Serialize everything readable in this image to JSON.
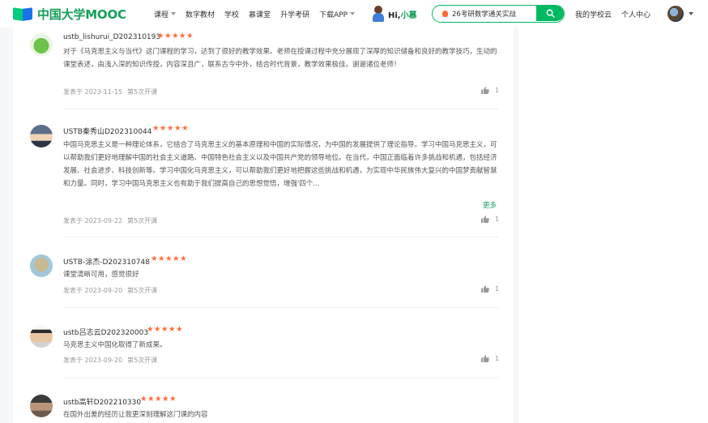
{
  "header": {
    "logo_text": "中国大学MOOC",
    "nav": [
      {
        "label": "课程",
        "dropdown": true
      },
      {
        "label": "数字教材",
        "dropdown": false
      },
      {
        "label": "学校",
        "dropdown": false
      },
      {
        "label": "慕课堂",
        "dropdown": false
      },
      {
        "label": "升学考研",
        "dropdown": false
      },
      {
        "label": "下载APP",
        "dropdown": true
      }
    ],
    "promo": {
      "hi": "Hi,",
      "name": "小慕"
    },
    "search": {
      "value": "26考研数学通关实战"
    },
    "links": {
      "my_school_cloud": "我的学校云",
      "personal_center": "个人中心"
    }
  },
  "colors": {
    "brand_green": "#00b960",
    "star_orange": "#ff6d3a",
    "more_green": "#14a05a"
  },
  "reviews": [
    {
      "username": "ustb_lishurui_D202310193",
      "stars": "★★★★★",
      "text": "对于《马克思主义与当代》这门课程的学习，达到了很好的教学效果。老师在授课过程中充分展现了深厚的知识储备和良好的教学技巧，生动的课堂表述，由浅入深的知识传授，内容深且广，联系古今中外，结合时代背景，教学效果极佳。谢谢诸位老师！",
      "date": "发表于 2023-11-15",
      "session": "第5次开课",
      "likes": "1"
    },
    {
      "username": "USTB秦秀山D202310044",
      "stars": "★★★★★",
      "text": "中国马克思主义是一种理论体系，它结合了马克思主义的基本原理和中国的实际情况，为中国的发展提供了理论指导。学习中国马克思主义，可以帮助我们更好地理解中国的社会主义道路、中国特色社会主义以及中国共产党的领导地位。在当代，中国正面临着许多挑战和机遇，包括经济发展、社会进步、科技创新等。学习中国化马克思主义，可以帮助我们更好地把握这些挑战和机遇，为实现中华民族伟大复兴的中国梦贡献智慧和力量。同时，学习中国马克思主义也有助于我们提高自己的思想觉悟，增强'四个...",
      "more": "更多",
      "date": "发表于 2023-09-22",
      "session": "第5次开课",
      "likes": "1"
    },
    {
      "username": "USTB-涂杰-D202310748",
      "stars": "★★★★★",
      "text": "课堂清晰可用，感觉很好",
      "date": "发表于 2023-09-20",
      "session": "第5次开课",
      "likes": "1"
    },
    {
      "username": "ustb吕志云D202320003",
      "stars": "★★★★★",
      "text": "马克思主义中国化取得了新成果。",
      "date": "发表于 2023-09-20",
      "session": "第5次开课",
      "likes": "1"
    },
    {
      "username": "ustb高轩D202210330",
      "stars": "★★★★★",
      "text": "在国外出差的经历让我更深刻理解这门课的内容"
    }
  ]
}
